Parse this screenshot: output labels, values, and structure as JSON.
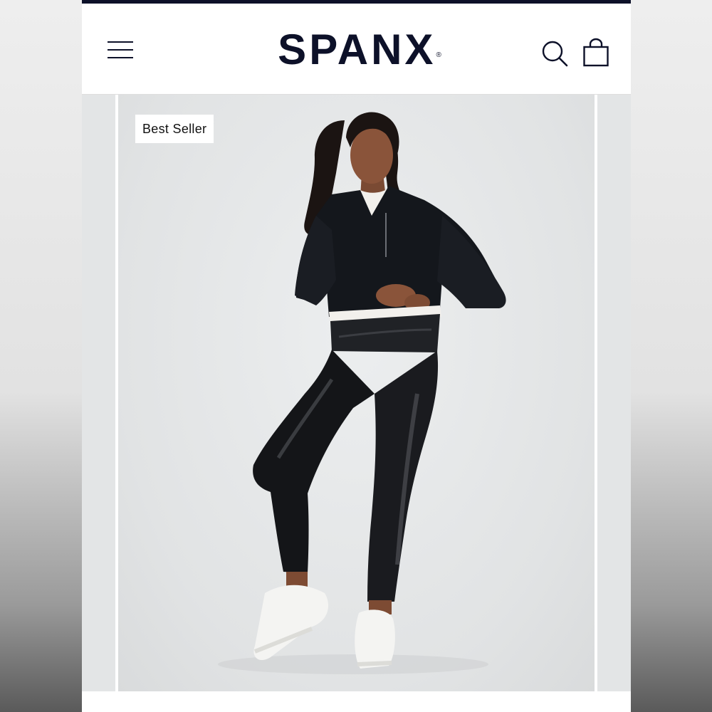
{
  "header": {
    "logo_text": "SPANX",
    "logo_mark": "®",
    "menu_icon": "hamburger-menu-icon",
    "search_icon": "search-icon",
    "bag_icon": "shopping-bag-icon"
  },
  "product": {
    "badge": "Best Seller",
    "image_description_icon": "model-wearing-faux-leather-leggings"
  },
  "colors": {
    "brand_navy": "#0d1129",
    "gallery_background": "#e4e6e7",
    "badge_background": "#ffffff"
  }
}
